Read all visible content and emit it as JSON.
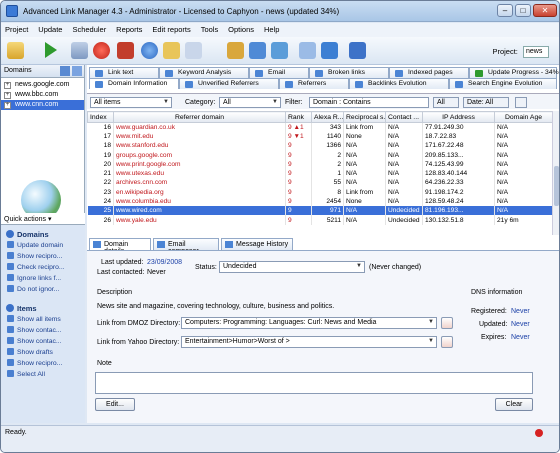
{
  "window": {
    "title": "Advanced Link Manager 4.3 - Administrator - Licensed to Caphyon - news (updated 34%)"
  },
  "menu": [
    "Project",
    "Update",
    "Scheduler",
    "Reports",
    "Edit reports",
    "Tools",
    "Options",
    "Help"
  ],
  "toolbar": {
    "project_label": "Project:",
    "project_value": "news"
  },
  "left": {
    "header": "Domains",
    "domains": [
      "news.google.com",
      "www.bbc.com",
      "www.cnn.com"
    ],
    "quick_actions": "Quick actions",
    "sections": [
      {
        "title": "Domains",
        "items": [
          "Update domain",
          "Show recipro...",
          "Check recipro...",
          "Ignore links f...",
          "Do not ignor..."
        ]
      },
      {
        "title": "Items",
        "items": [
          "Show all items",
          "Show contac...",
          "Show contac...",
          "Show drafts",
          "Show recipro...",
          "Select All"
        ]
      }
    ]
  },
  "tabs_row1": [
    "Link text",
    "Keyword Analysis",
    "Email",
    "Broken links",
    "Indexed pages",
    "Update Progress - 34%"
  ],
  "tabs_row2": [
    "Domain Information",
    "Unverified Referrers",
    "Referrers",
    "Backlinks Evolution",
    "Search Engine Evolution"
  ],
  "filter": {
    "view": "All items",
    "category_label": "Category:",
    "category": "All",
    "filter_label": "Filter:",
    "filter_value": "Domain : Contains",
    "all_btn": "All",
    "date_btn": "Date: All"
  },
  "table": {
    "headers": [
      "Index",
      "Referrer domain",
      "Rank",
      "Alexa R...",
      "Reciprocal s...",
      "Contact ...",
      "IP Address",
      "Domain Age"
    ],
    "rows": [
      [
        "16",
        "www.guardian.co.uk",
        "9 ▲1",
        "343",
        "Link from",
        "N/A",
        "77.91.249.30",
        "N/A"
      ],
      [
        "17",
        "www.mit.edu",
        "9 ▼1",
        "1140",
        "None",
        "N/A",
        "18.7.22.83",
        "N/A"
      ],
      [
        "18",
        "www.stanford.edu",
        "9",
        "1366",
        "N/A",
        "N/A",
        "171.67.22.48",
        "N/A"
      ],
      [
        "19",
        "groups.google.com",
        "9",
        "2",
        "N/A",
        "N/A",
        "209.85.133...",
        "N/A"
      ],
      [
        "20",
        "www.print.google.com",
        "9",
        "2",
        "N/A",
        "N/A",
        "74.125.43.99",
        "N/A"
      ],
      [
        "21",
        "www.utexas.edu",
        "9",
        "1",
        "N/A",
        "N/A",
        "128.83.40.144",
        "N/A"
      ],
      [
        "22",
        "archives.cnn.com",
        "9",
        "55",
        "N/A",
        "N/A",
        "64.236.22.33",
        "N/A"
      ],
      [
        "23",
        "en.wikipedia.org",
        "9",
        "8",
        "Link from",
        "N/A",
        "91.198.174.2",
        "N/A"
      ],
      [
        "24",
        "www.columbia.edu",
        "9",
        "2454",
        "None",
        "N/A",
        "128.59.48.24",
        "N/A"
      ],
      [
        "25",
        "www.wired.com",
        "9",
        "971",
        "N/A",
        "Undecided",
        "81.196.193...",
        "N/A"
      ],
      [
        "26",
        "www.yale.edu",
        "9",
        "5211",
        "N/A",
        "Undecided",
        "130.132.51.8",
        "21y 6m"
      ]
    ]
  },
  "detail_tabs": [
    "Domain details",
    "Email composer",
    "Message History"
  ],
  "details": {
    "last_updated_label": "Last updated:",
    "last_updated": "23/09/2008",
    "last_contacted_label": "Last contacted:",
    "last_contacted": "Never",
    "status_label": "Status:",
    "status": "Undecided",
    "never_changed": "(Never changed)",
    "description_label": "Description",
    "description": "News site and magazine, covering technology, culture, business and politics.",
    "dmoz_label": "Link from DMOZ Directory:",
    "dmoz": "Computers: Programming: Languages: Curl: News and Media",
    "yahoo_label": "Link from Yahoo Directory:",
    "yahoo": "Entertainment>Humor>Worst of    >",
    "dns_label": "DNS information",
    "registered_label": "Registered:",
    "registered": "Never",
    "updated_label": "Updated:",
    "updated": "Never",
    "expires_label": "Expires:",
    "expires": "Never",
    "note_label": "Note",
    "edit_btn": "Edit...",
    "clear_btn": "Clear"
  },
  "status": {
    "text": "Ready."
  }
}
